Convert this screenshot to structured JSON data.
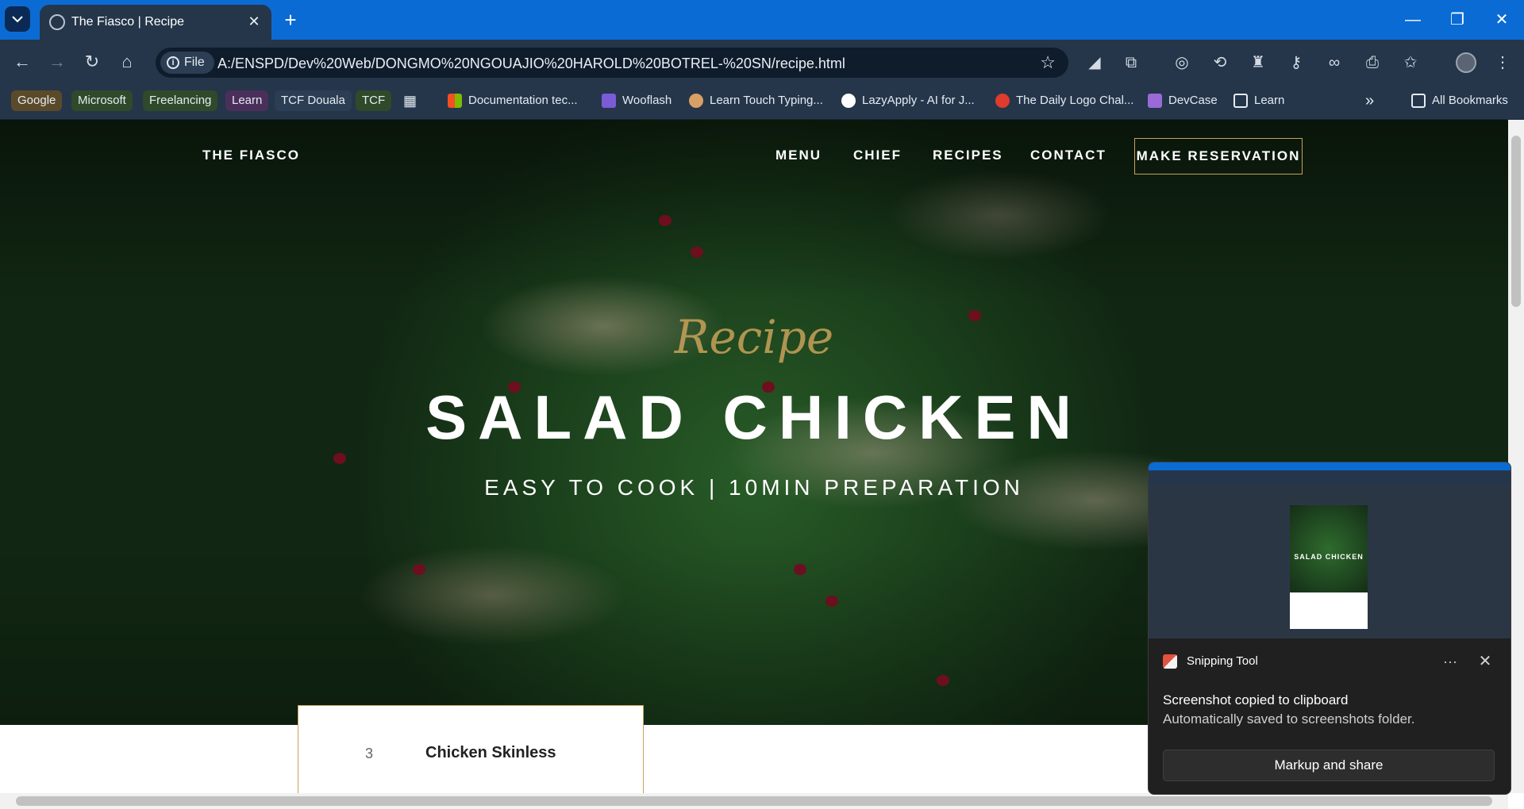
{
  "browser": {
    "tab_title": "The Fiasco | Recipe",
    "tab_close": "✕",
    "new_tab": "+",
    "window_controls": {
      "minimize": "—",
      "restore": "❐",
      "close": "✕"
    },
    "nav": {
      "back": "←",
      "forward": "→",
      "reload": "↻",
      "home": "⌂"
    },
    "omnibox": {
      "chip_label": "File",
      "url": "A:/ENSPD/Dev%20Web/DONGMO%20NGOUAJIO%20HAROLD%20BOTREL-%20SN/recipe.html"
    },
    "bookmarks": [
      {
        "label": "Google",
        "bg": "#5b4a2a"
      },
      {
        "label": "Microsoft",
        "bg": "#2f4a2a"
      },
      {
        "label": "Freelancing",
        "bg": "#2f4a2a"
      },
      {
        "label": "Learn",
        "bg": "#4a2f5b"
      },
      {
        "label": "TCF Douala",
        "bg": "#2c3e53"
      },
      {
        "label": "TCF",
        "bg": "#2f4a2a"
      }
    ],
    "bookmark_links": [
      {
        "label": "Documentation tec..."
      },
      {
        "label": "Wooflash"
      },
      {
        "label": "Learn Touch Typing..."
      },
      {
        "label": "LazyApply - AI for J..."
      },
      {
        "label": "The Daily Logo Chal..."
      },
      {
        "label": "DevCase"
      },
      {
        "label": "Learn"
      }
    ],
    "overflow": "»",
    "all_bookmarks": "All Bookmarks"
  },
  "site": {
    "brand": "THE FIASCO",
    "nav_links": [
      "MENU",
      "CHIEF",
      "RECIPES",
      "CONTACT"
    ],
    "cta": "MAKE RESERVATION",
    "hero": {
      "script": "Recipe",
      "title": "SALAD CHICKEN",
      "subtitle": "EASY TO COOK | 10MIN PREPARATION"
    },
    "ingredients": [
      {
        "qty": "3",
        "name": "Chicken Skinless"
      }
    ]
  },
  "toast": {
    "app_name": "Snipping Tool",
    "more": "···",
    "close": "✕",
    "message": "Screenshot copied to clipboard",
    "detail": "Automatically saved to screenshots folder.",
    "action": "Markup and share",
    "thumb_title": "SALAD CHICKEN"
  },
  "colors": {
    "accent_gold": "#c9a25a",
    "chrome_blue": "#0b6bd4",
    "chrome_dark": "#25364a"
  }
}
